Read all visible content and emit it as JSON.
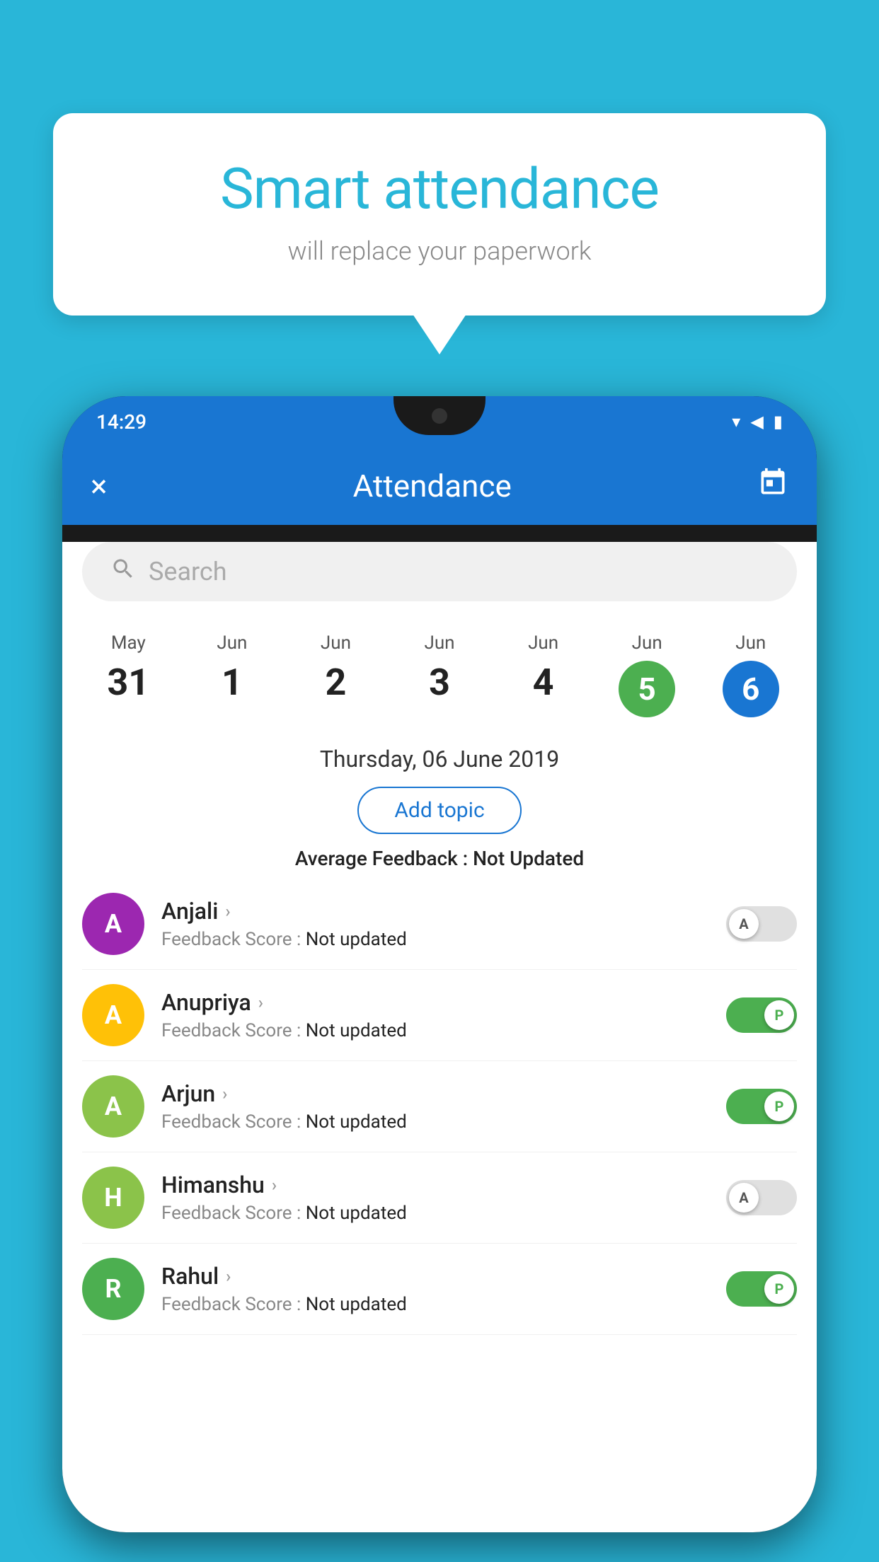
{
  "background_color": "#29b6d8",
  "speech_bubble": {
    "title": "Smart attendance",
    "subtitle": "will replace your paperwork"
  },
  "status_bar": {
    "time": "14:29",
    "icons": [
      "wifi",
      "signal",
      "battery"
    ]
  },
  "app_bar": {
    "title": "Attendance",
    "close_label": "×",
    "calendar_label": "📅"
  },
  "search": {
    "placeholder": "Search"
  },
  "dates": [
    {
      "month": "May",
      "day": "31",
      "type": "normal"
    },
    {
      "month": "Jun",
      "day": "1",
      "type": "normal"
    },
    {
      "month": "Jun",
      "day": "2",
      "type": "normal"
    },
    {
      "month": "Jun",
      "day": "3",
      "type": "normal"
    },
    {
      "month": "Jun",
      "day": "4",
      "type": "normal"
    },
    {
      "month": "Jun",
      "day": "5",
      "type": "today-green"
    },
    {
      "month": "Jun",
      "day": "6",
      "type": "today-blue"
    }
  ],
  "selected_date": "Thursday, 06 June 2019",
  "add_topic_label": "Add topic",
  "avg_feedback_label": "Average Feedback : ",
  "avg_feedback_value": "Not Updated",
  "students": [
    {
      "name": "Anjali",
      "initial": "A",
      "avatar_color": "#9c27b0",
      "feedback_label": "Feedback Score : ",
      "feedback_value": "Not updated",
      "toggle": "off",
      "toggle_label": "A"
    },
    {
      "name": "Anupriya",
      "initial": "A",
      "avatar_color": "#ffc107",
      "feedback_label": "Feedback Score : ",
      "feedback_value": "Not updated",
      "toggle": "on",
      "toggle_label": "P"
    },
    {
      "name": "Arjun",
      "initial": "A",
      "avatar_color": "#8bc34a",
      "feedback_label": "Feedback Score : ",
      "feedback_value": "Not updated",
      "toggle": "on",
      "toggle_label": "P"
    },
    {
      "name": "Himanshu",
      "initial": "H",
      "avatar_color": "#8bc34a",
      "feedback_label": "Feedback Score : ",
      "feedback_value": "Not updated",
      "toggle": "off",
      "toggle_label": "A"
    },
    {
      "name": "Rahul",
      "initial": "R",
      "avatar_color": "#4caf50",
      "feedback_label": "Feedback Score : ",
      "feedback_value": "Not updated",
      "toggle": "on",
      "toggle_label": "P"
    }
  ]
}
